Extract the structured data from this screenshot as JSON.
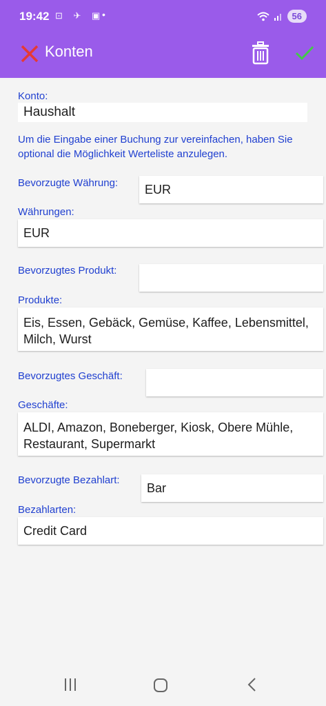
{
  "status": {
    "time": "19:42",
    "extra_icons": "⊡ ✈ ▣",
    "dot": "•",
    "battery": "56"
  },
  "appbar": {
    "title": "Konten"
  },
  "konto": {
    "label": "Konto:",
    "value": "Haushalt"
  },
  "hint": "Um die Eingabe einer Buchung zur vereinfachen, haben Sie optional die Möglichkeit Werteliste anzulegen.",
  "waehrung": {
    "preferred_label": "Bevorzugte Währung:",
    "preferred_value": "EUR",
    "list_label": "Währungen:",
    "list_value": "EUR"
  },
  "produkt": {
    "preferred_label": "Bevorzugtes Produkt:",
    "preferred_value": "",
    "list_label": "Produkte:",
    "list_value": "Eis, Essen, Gebäck, Gemüse, Kaffee, Lebensmittel, Milch, Wurst"
  },
  "geschaeft": {
    "preferred_label": "Bevorzugtes Geschäft:",
    "preferred_value": "",
    "list_label": "Geschäfte:",
    "list_value": "ALDI, Amazon, Boneberger, Kiosk, Obere Mühle, Restaurant, Supermarkt"
  },
  "bezahlart": {
    "preferred_label": "Bevorzugte Bezahlart:",
    "preferred_value": "Bar",
    "list_label": "Bezahlarten:",
    "list_value": "Credit Card"
  },
  "colors": {
    "accent": "#9a5bea",
    "label": "#2040d0",
    "close": "#e53935",
    "check": "#43c94a"
  }
}
